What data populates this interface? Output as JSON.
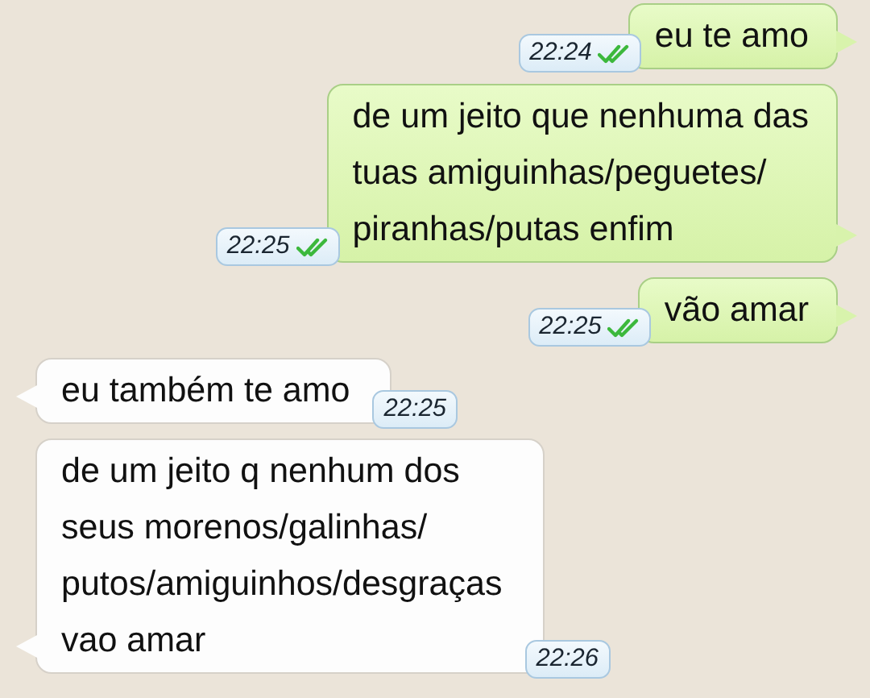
{
  "messages": [
    {
      "kind": "outgoing",
      "text": "eu te amo",
      "time": "22:24",
      "read": true
    },
    {
      "kind": "outgoing",
      "text": "de um jeito que nenhuma das\ntuas amiguinhas/peguetes/\npiranhas/putas enfim",
      "time": "22:25",
      "read": true
    },
    {
      "kind": "outgoing",
      "text": "vão amar",
      "time": "22:25",
      "read": true
    },
    {
      "kind": "incoming",
      "text": "eu também te amo",
      "time": "22:25"
    },
    {
      "kind": "incoming",
      "text": "de um jeito q nenhum dos\nseus morenos/galinhas/\nputos/amiguinhos/desgraças\nvao amar",
      "time": "22:26"
    }
  ]
}
